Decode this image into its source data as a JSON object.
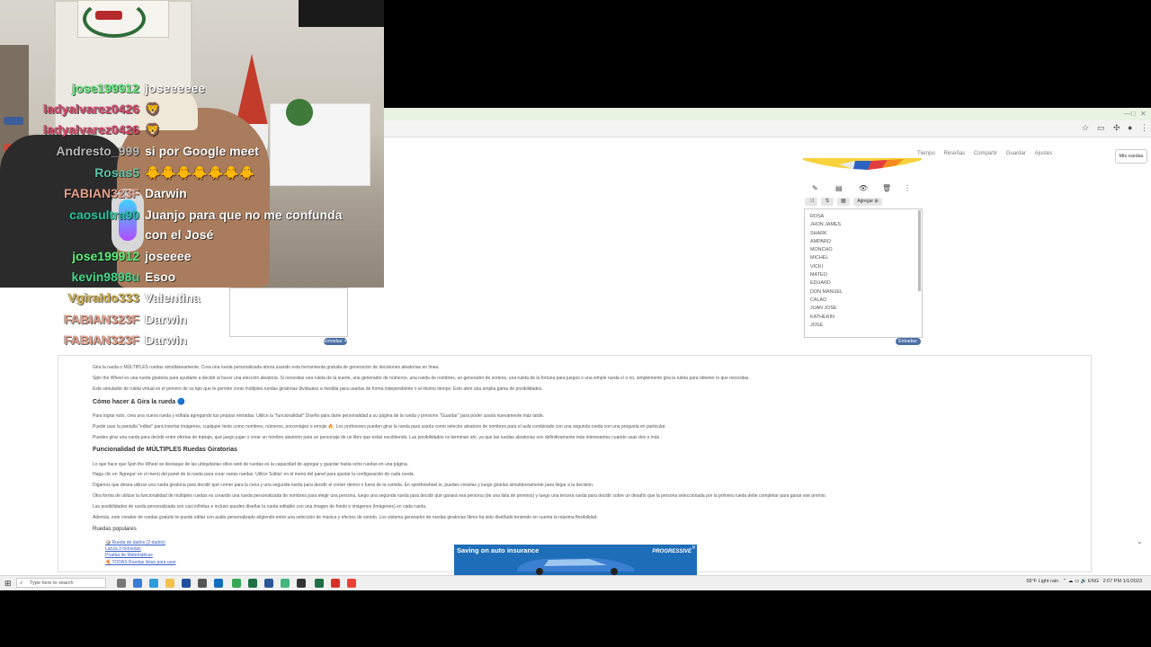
{
  "browser": {
    "window_controls": [
      "—",
      "□",
      "✕"
    ],
    "toolbar_icons": [
      "star-icon",
      "sidebar-icon",
      "puzzle-icon",
      "profile-icon",
      "menu-icon"
    ]
  },
  "site_nav": {
    "items": [
      "Tiempo",
      "Reseñas",
      "Compartir",
      "Guardar",
      "Ajustes"
    ],
    "my_wheels": "Mis ruedas"
  },
  "left_wheel": {
    "count_label": "Entradas: 4"
  },
  "right_wheel": {
    "toolbar": [
      "✎",
      "▤",
      "👁",
      "🗑",
      "⋮"
    ],
    "subtoolbar": [
      "⤨",
      "⇅",
      "▦"
    ],
    "add_label": "Agregar ⊞",
    "names": [
      "ROSA",
      "JHON JAMES",
      "SHARK",
      "AMPARO",
      "MONCHO",
      "MICHEL",
      "VICKI",
      "MATEO",
      "EDUARD",
      "DON MANUEL",
      "CALAO",
      "JUAN JOSE",
      "KATHERIN",
      "JOSE"
    ],
    "count_label": "Entradas: 44"
  },
  "article": {
    "intro": "Gira la rueda o MÚLTIPLES ruedas simultáneamente. Crea una rueda personalizada ahora usando esta herramienta gratuita de generación de decisiones aleatorias en línea.",
    "p2": "Spin the Wheel es una rueda giratoria para ayudarte a decidir al hacer una elección aleatoria. Si necesitas una ruleta de la suerte, una generador de números, una rueda de nombres, un generador de sorteos, una ruleta de la fortuna para juegos o una simple rueda sí o no, simplemente gira la ruleta para obtener lo que necesitas.",
    "p3": "Este simulador de ruleta virtual es el primero de su tipo que te permite crear múltiples ruedas giratorias dividuales a medida para usarlas de forma independiente o al mismo tiempo. Esto abre una amplia gama de posibilidades.",
    "h_howto": "Cómo hacer & Gira la rueda 🔵",
    "p4": "Para lograr esto, crea una nueva rueda y edítala agregando tus propias entradas. Utilice la \"funcionalidad\" Diseño para darle personalidad a su página de la rueda y presione \"Guardar\" para poder usarla nuevamente más tarde.",
    "p5": "Puede usar la pantalla \"editar\" para insertar imágenes, cualquier texto como nombres, números, porcentajes o emojis 🔥. Los profesores pueden girar la rueda para usarla como selector aleatorio de nombres para el aula combinado con una segunda rueda con una pregunta en particular.",
    "p6": "Puedes girar una rueda para decidir entre ofertas de trabajo, qué juego jugar o crear un nombre aleatorio para un personaje de un libro que estás escribiendo. Las posibilidades no terminan ahí, ya que las ruedas aleatorias son definitivamente más interesantes cuando usas dos o más .",
    "h_multi": "Funcionalidad de MÚLTIPLES Ruedas Giratorias",
    "p7": "Lo que hace que Spin the Wheel se destaque de las ubiquitarias sitios web de ruedas es la capacidad de agregar y guardar hasta ocho ruedas en una página.",
    "p8": "Haga clic en 'Agregar' en el menú del panel de la rueda para crear varias ruedas. Utilice 'Editar' en el menú del panel para ajustar la configuración de cada rueda.",
    "p9": "Digamos que desea utilizar una rueda giratoria para decidir qué comer para la cena y una segunda rueda para decidir el comer dentro o fuera de la comida. En spinthewheel.io, puedes crearlas y luego girarlas simultáneamente para llegar a la decisión.",
    "p10": "Otra forma de utilizar la funcionalidad de múltiples ruedas es creando una rueda personalizada de nombres para elegir una persona, luego una segunda rueda para decidir qué ganará esa persona (de una lista de premios) y luego una tercera rueda para decidir sobre un desafío que la persona seleccionada por la primera rueda debe completar para ganar ese premio.",
    "p11": "Las posibilidades de rueda personalizada son casi infinitas e incluso puedes diseñar la rueda editable con una imagen de fondo e imágenes (imágenes) en cada rueda.",
    "p12": "Además, este creador de ruedas gratuito te puede editar con audio personalizado eligiendo entre una selección de música y efectos de sonido. Los sistema generador de ruedas giratorias libres ha sido diseñado teniendo en cuenta la máxima flexibilidad.",
    "h_popular": "Ruedas populares",
    "popular": [
      "🎲 Rueda de dados (2 dados)",
      "Lanza 3 monedas",
      "Prueba de Matemáticas",
      "🍕 TODAS Ruedas listas para usar"
    ]
  },
  "ad": {
    "title": "Saving on auto insurance",
    "brand": "PROGRESSIVE",
    "close": "✕"
  },
  "taskbar": {
    "search_placeholder": "Type here to search",
    "tray_weather": "58°F Light rain",
    "tray_time": "2:07 PM",
    "tray_date": "1/1/2023"
  },
  "chat": [
    {
      "user": "jose199912",
      "msg": "joseeeeee",
      "color": "#5cf07a"
    },
    {
      "user": "ladyalvarez0426",
      "msg": "🦁",
      "color": "#e0456a"
    },
    {
      "user": "ladyalvarez0426",
      "msg": "🦁",
      "color": "#e0456a"
    },
    {
      "user": "Andresto_999",
      "msg": "si por Google meet",
      "color": "#b8b8b8"
    },
    {
      "user": "Rosas5",
      "msg": "🐥🐥🐥🐥🐥🐥🐥",
      "color": "#5cc5a8"
    },
    {
      "user": "FABIAN323F",
      "msg": "Darwin",
      "color": "#e8a08a"
    },
    {
      "user": "caosultra90",
      "msg": "Juanjo para que no me confunda",
      "color": "#23c7a1"
    },
    {
      "user": "",
      "msg": "con el José",
      "color": "#ffffff"
    },
    {
      "user": "jose199912",
      "msg": "joseeee",
      "color": "#5cf07a"
    },
    {
      "user": "kevin9898u",
      "msg": "Esoo",
      "color": "#44d98a"
    },
    {
      "user": "Vgiraldo333",
      "msg": "Valentina",
      "color": "#d5b24a"
    },
    {
      "user": "FABIAN323F",
      "msg": "Darwin",
      "color": "#e8a08a"
    },
    {
      "user": "FABIAN323F",
      "msg": "Darwin",
      "color": "#e8a08a"
    }
  ]
}
